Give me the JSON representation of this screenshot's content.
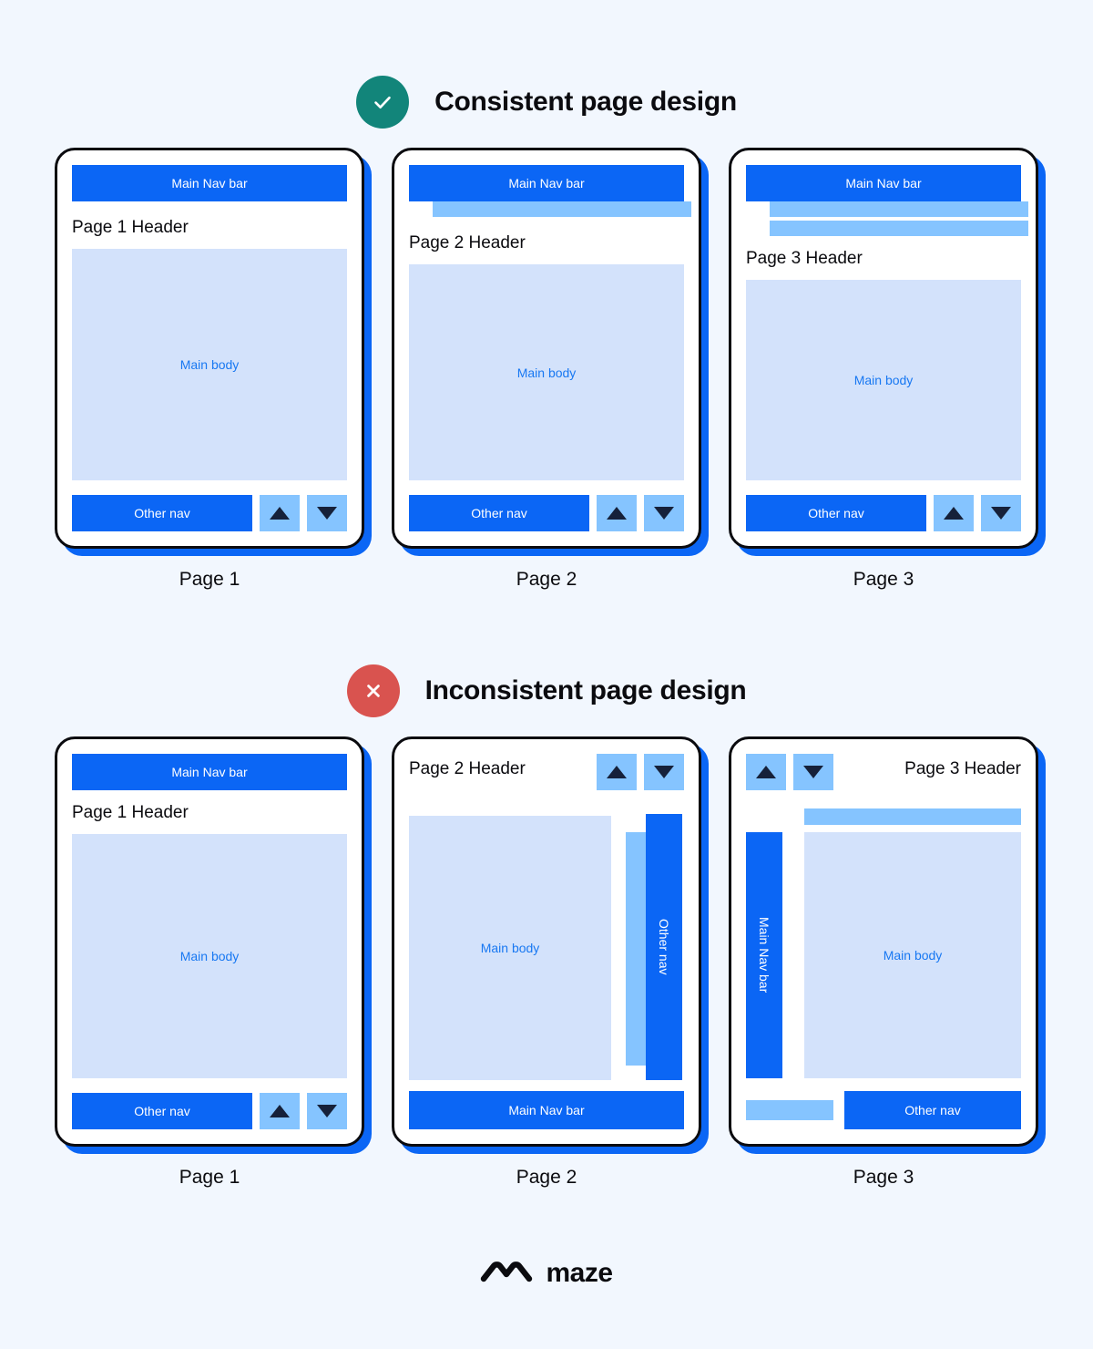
{
  "background_color": "#f2f7fe",
  "colors": {
    "primary_blue": "#0b66f5",
    "light_blue": "#85c4ff",
    "body_fill": "#d3e2fb",
    "body_text": "#1878f2",
    "ink": "#0b0b0f",
    "success_teal": "#12857a",
    "error_red": "#d9534f",
    "arrow_dark": "#16213a"
  },
  "sections": [
    {
      "id": "consistent",
      "badge_icon": "check-icon",
      "badge_color": "#12857a",
      "title": "Consistent page design",
      "cards": [
        {
          "caption": "Page 1",
          "nav_label": "Main Nav bar",
          "header": "Page 1 Header",
          "body_label": "Main body",
          "other_nav_label": "Other nav",
          "sub_bars": 0,
          "arrows": [
            "up",
            "down"
          ]
        },
        {
          "caption": "Page 2",
          "nav_label": "Main Nav bar",
          "header": "Page 2 Header",
          "body_label": "Main body",
          "other_nav_label": "Other nav",
          "sub_bars": 1,
          "arrows": [
            "up",
            "down"
          ]
        },
        {
          "caption": "Page 3",
          "nav_label": "Main Nav bar",
          "header": "Page 3 Header",
          "body_label": "Main body",
          "other_nav_label": "Other nav",
          "sub_bars": 2,
          "arrows": [
            "up",
            "down"
          ]
        }
      ]
    },
    {
      "id": "inconsistent",
      "badge_icon": "cross-icon",
      "badge_color": "#d9534f",
      "title": "Inconsistent page design",
      "cards": [
        {
          "caption": "Page 1",
          "nav_label": "Main Nav bar",
          "header": "Page 1 Header",
          "body_label": "Main body",
          "other_nav_label": "Other nav",
          "arrows": [
            "up",
            "down"
          ]
        },
        {
          "caption": "Page 2",
          "nav_label": "Main Nav bar",
          "header": "Page 2 Header",
          "body_label": "Main body",
          "other_nav_label": "Other nav",
          "arrows": [
            "up",
            "down"
          ]
        },
        {
          "caption": "Page 3",
          "nav_label": "Main Nav bar",
          "header": "Page 3 Header",
          "body_label": "Main body",
          "other_nav_label": "Other nav",
          "arrows": [
            "up",
            "down"
          ]
        }
      ]
    }
  ],
  "footer": {
    "logo_icon": "maze-logo-icon",
    "brand": "maze"
  }
}
